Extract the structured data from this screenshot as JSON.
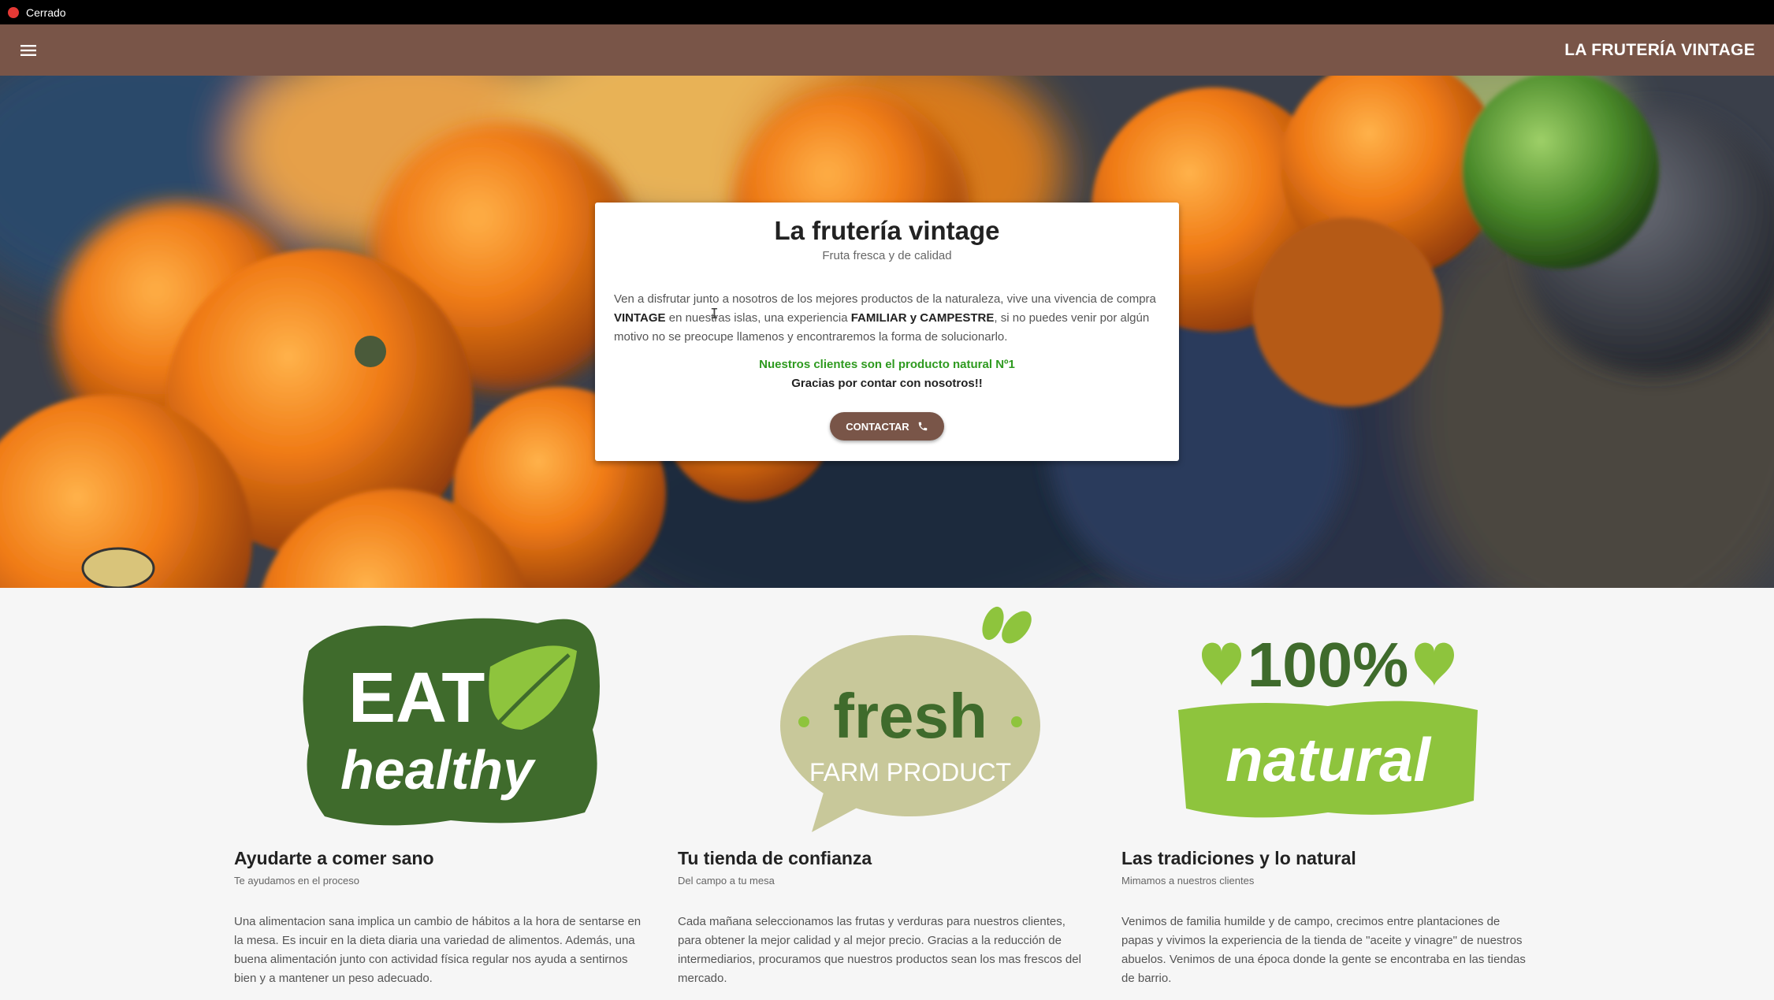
{
  "statusbar": {
    "label": "Cerrado",
    "dot_color": "#e53935"
  },
  "appbar": {
    "menu_icon": "hamburger-menu-icon",
    "brand": "LA FRUTERÍA VINTAGE",
    "color": "#795548"
  },
  "hero_card": {
    "title": "La frutería vintage",
    "subtitle": "Fruta fresca y de calidad",
    "text_1": "Ven a disfrutar junto a nosotros de los mejores productos de la naturaleza, vive una vivencia de compra ",
    "bold_1": "VINTAGE",
    "text_2": " en nuestras islas, una experiencia ",
    "bold_2": "FAMILIAR y CAMPESTRE",
    "text_3": ", si no puedes venir por algún motivo no se preocupe llamenos y encontraremos la forma de solucionarlo.",
    "highlight": "Nuestros clientes son el producto natural Nº1",
    "thanks": "Gracias por contar con nosotros!!",
    "contact_button": "CONTACTAR",
    "contact_icon": "phone-icon"
  },
  "features": [
    {
      "logo_line_1": "EAT",
      "logo_line_2": "healthy",
      "title": "Ayudarte a comer sano",
      "subtitle": "Te ayudamos en el proceso",
      "text": "Una alimentacion sana implica un cambio de hábitos a la hora de sentarse en la mesa. Es incuir en la dieta diaria una variedad de alimentos. Además, una buena alimentación junto con actividad física regular nos ayuda a sentirnos bien y a mantener un peso adecuado."
    },
    {
      "logo_line_1": "fresh",
      "logo_line_2": "FARM PRODUCT",
      "title": "Tu tienda de confianza",
      "subtitle": "Del campo a tu mesa",
      "text": "Cada mañana seleccionamos las frutas y verduras para nuestros clientes, para obtener la mejor calidad y al mejor precio. Gracias a la reducción de intermediarios, procuramos que nuestros productos sean los mas frescos del mercado."
    },
    {
      "logo_line_1": "100%",
      "logo_line_2": "natural",
      "title": "Las tradiciones y lo natural",
      "subtitle": "Mimamos a nuestros clientes",
      "text": "Venimos de familia humilde y de campo, crecimos entre plantaciones de papas y vivimos la experiencia de la tienda de \"aceite y vinagre\" de nuestros abuelos. Venimos de una época donde la gente se encontraba en las tiendas de barrio."
    }
  ]
}
